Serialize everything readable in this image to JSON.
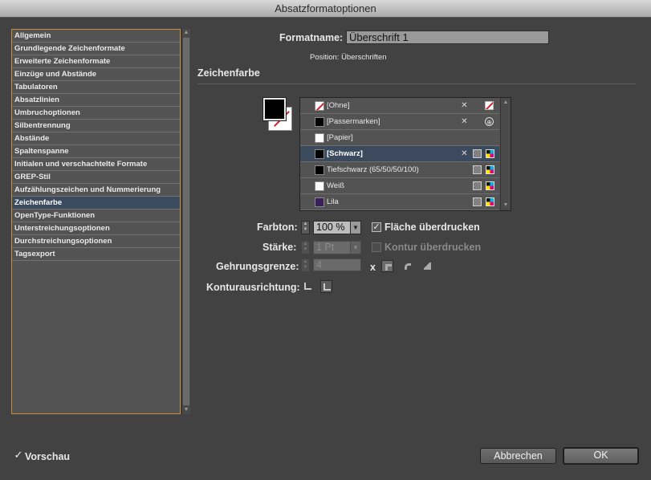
{
  "window": {
    "title": "Absatzformatoptionen"
  },
  "sidebar": {
    "items": [
      {
        "label": "Allgemein"
      },
      {
        "label": "Grundlegende Zeichenformate"
      },
      {
        "label": "Erweiterte Zeichenformate"
      },
      {
        "label": "Einzüge und Abstände"
      },
      {
        "label": "Tabulatoren"
      },
      {
        "label": "Absatzlinien"
      },
      {
        "label": "Umbruchoptionen"
      },
      {
        "label": "Silbentrennung"
      },
      {
        "label": "Abstände"
      },
      {
        "label": "Spaltenspanne"
      },
      {
        "label": "Initialen und verschachtelte Formate"
      },
      {
        "label": "GREP-Stil"
      },
      {
        "label": "Aufzählungszeichen und Nummerierung"
      },
      {
        "label": "Zeichenfarbe",
        "selected": true
      },
      {
        "label": "OpenType-Funktionen"
      },
      {
        "label": "Unterstreichungsoptionen"
      },
      {
        "label": "Durchstreichungsoptionen"
      },
      {
        "label": "Tagsexport"
      }
    ]
  },
  "header": {
    "formatname_label": "Formatname:",
    "formatname_value": "Überschrift 1",
    "position_text": "Position:  Überschriften",
    "section_title": "Zeichenfarbe"
  },
  "swatches": [
    {
      "name": "[Ohne]",
      "chip": "none",
      "icons": [
        "no-edit-icon",
        "none-swatch-icon"
      ]
    },
    {
      "name": "[Passermarken]",
      "chip": "#000000",
      "icons": [
        "no-edit-icon",
        "registration-icon"
      ]
    },
    {
      "name": "[Papier]",
      "chip": "#ffffff",
      "icons": []
    },
    {
      "name": "[Schwarz]",
      "chip": "#000000",
      "selected": true,
      "icons": [
        "no-edit-icon",
        "process-color-icon",
        "cmyk-icon"
      ]
    },
    {
      "name": "Tiefschwarz (65/50/50/100)",
      "chip": "#000000",
      "icons": [
        "process-color-icon",
        "cmyk-icon"
      ]
    },
    {
      "name": "Weiß",
      "chip": "#ffffff",
      "icons": [
        "process-color-icon",
        "cmyk-icon"
      ]
    },
    {
      "name": "Lila",
      "chip": "#3a1f5c",
      "icons": [
        "process-color-icon",
        "cmyk-icon"
      ]
    }
  ],
  "controls": {
    "farbton_label": "Farbton:",
    "farbton_value": "100 %",
    "flaeche_ueberdrucken_label": "Fläche überdrucken",
    "flaeche_ueberdrucken_checked": true,
    "staerke_label": "Stärke:",
    "staerke_value": "1 Pt",
    "kontur_ueberdrucken_label": "Kontur überdrucken",
    "kontur_ueberdrucken_checked": false,
    "gehrungsgrenze_label": "Gehrungsgrenze:",
    "gehrungsgrenze_value": "4",
    "gehrung_x": "x",
    "konturausrichtung_label": "Konturausrichtung:"
  },
  "footer": {
    "vorschau_label": "Vorschau",
    "vorschau_checked": true,
    "cancel_label": "Abbrechen",
    "ok_label": "OK"
  },
  "check_glyph": "✓",
  "colors": {
    "selection": "#3c4a5e",
    "list_border_accent": "#c58d3c",
    "none_red": "#d51f26"
  }
}
